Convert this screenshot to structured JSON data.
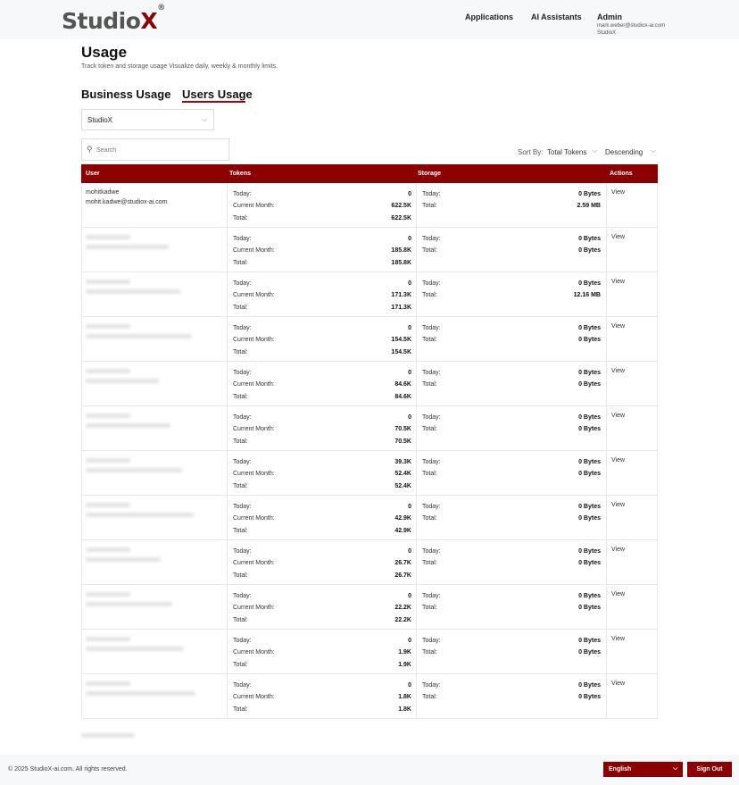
{
  "header": {
    "logo": "Studio",
    "logo_x": "X",
    "logo_reg": "®",
    "nav": [
      "Applications",
      "AI Assistants"
    ],
    "admin": {
      "name": "Admin",
      "email": "mark.weber@studiox-ai.com",
      "org": "StudioX"
    }
  },
  "page": {
    "title": "Usage",
    "subtitle": "Track token and storage usage Visualize daily, weekly & monthly limits.",
    "tabs": [
      "Business Usage",
      "Users Usage"
    ],
    "active_tab": "Users Usage",
    "org_select": "StudioX",
    "search_placeholder": "Search",
    "sort_label": "Sort By:",
    "sort_field": "Total Tokens",
    "sort_order": "Descending"
  },
  "table": {
    "headers": [
      "User",
      "Tokens",
      "Storage",
      "Actions"
    ],
    "labels": {
      "today": "Today:",
      "month": "Current Month:",
      "total": "Total:"
    },
    "view_label": "View",
    "rows": [
      {
        "name": "mohitkadwe",
        "email": "mohit.kadwe@studiox-ai.com",
        "today": "0",
        "month": "622.5K",
        "total": "622.5K",
        "st_today": "0 Bytes",
        "st_total": "2.59 MB"
      },
      {
        "name": "",
        "email": "",
        "today": "0",
        "month": "185.8K",
        "total": "185.8K",
        "st_today": "0 Bytes",
        "st_total": "0 Bytes"
      },
      {
        "name": "",
        "email": "",
        "today": "0",
        "month": "171.3K",
        "total": "171.3K",
        "st_today": "0 Bytes",
        "st_total": "12.16 MB"
      },
      {
        "name": "",
        "email": "",
        "today": "0",
        "month": "154.5K",
        "total": "154.5K",
        "st_today": "0 Bytes",
        "st_total": "0 Bytes"
      },
      {
        "name": "",
        "email": "",
        "today": "0",
        "month": "84.6K",
        "total": "84.6K",
        "st_today": "0 Bytes",
        "st_total": "0 Bytes"
      },
      {
        "name": "",
        "email": "",
        "today": "0",
        "month": "70.5K",
        "total": "70.5K",
        "st_today": "0 Bytes",
        "st_total": "0 Bytes"
      },
      {
        "name": "",
        "email": "",
        "today": "39.3K",
        "month": "52.4K",
        "total": "52.4K",
        "st_today": "0 Bytes",
        "st_total": "0 Bytes"
      },
      {
        "name": "",
        "email": "",
        "today": "0",
        "month": "42.9K",
        "total": "42.9K",
        "st_today": "0 Bytes",
        "st_total": "0 Bytes"
      },
      {
        "name": "",
        "email": "",
        "today": "0",
        "month": "26.7K",
        "total": "26.7K",
        "st_today": "0 Bytes",
        "st_total": "0 Bytes"
      },
      {
        "name": "",
        "email": "",
        "today": "0",
        "month": "22.2K",
        "total": "22.2K",
        "st_today": "0 Bytes",
        "st_total": "0 Bytes"
      },
      {
        "name": "",
        "email": "",
        "today": "0",
        "month": "1.9K",
        "total": "1.9K",
        "st_today": "0 Bytes",
        "st_total": "0 Bytes"
      },
      {
        "name": "",
        "email": "",
        "today": "0",
        "month": "1.8K",
        "total": "1.8K",
        "st_today": "0 Bytes",
        "st_total": "0 Bytes"
      }
    ]
  },
  "footer": {
    "copyright": "© 2025 StudioX-ai.com.  All rights reserved.",
    "language": "English",
    "signout": "Sign Out"
  },
  "colors": {
    "accent": "#8b0000",
    "header_bg": "#f7f8fa"
  },
  "icons": [
    "search-icon",
    "chevron-down-icon"
  ]
}
